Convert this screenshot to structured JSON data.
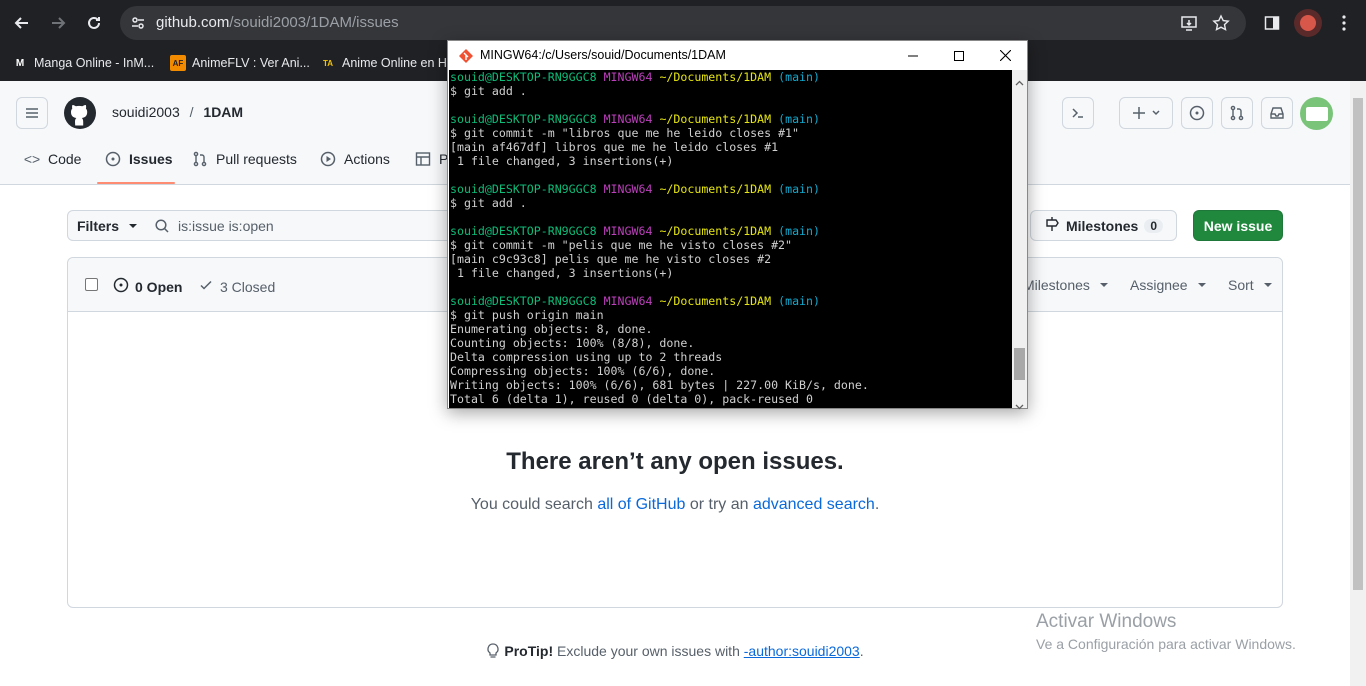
{
  "browser": {
    "url_host": "github.com",
    "url_path": "/souidi2003/1DAM/issues",
    "bookmarks": [
      {
        "label": "Manga Online - InM...",
        "icon": "M"
      },
      {
        "label": "AnimeFLV : Ver Ani...",
        "icon": "AF"
      },
      {
        "label": "Anime Online en H...",
        "icon": "TA"
      }
    ]
  },
  "github": {
    "owner": "souidi2003",
    "separator": "/",
    "repo": "1DAM",
    "tabs": {
      "code": "Code",
      "issues": "Issues",
      "pulls": "Pull requests",
      "actions": "Actions",
      "projects": "P"
    },
    "filters_label": "Filters",
    "search_value": "is:issue is:open",
    "milestones_label": "Milestones",
    "milestones_count": "0",
    "new_issue_label": "New issue",
    "open_label": "0 Open",
    "closed_label": "3 Closed",
    "milestones_filter": "Milestones",
    "assignee_filter": "Assignee",
    "sort_filter": "Sort",
    "blank_title": "There aren’t any open issues.",
    "blank_sub_prefix": "You could search ",
    "blank_sub_link1": "all of GitHub",
    "blank_sub_mid": " or try an ",
    "blank_sub_link2": "advanced search",
    "blank_sub_suffix": ".",
    "protip_bold": "ProTip!",
    "protip_text": " Exclude your own issues with ",
    "protip_code": "-author:souidi2003",
    "protip_end": "."
  },
  "windows_activation": {
    "title": "Activar Windows",
    "subtitle": "Ve a Configuración para activar Windows."
  },
  "terminal": {
    "title": "MINGW64:/c/Users/souid/Documents/1DAM",
    "prompt_user": "souid@DESKTOP-RN9GGC8",
    "prompt_env": "MINGW64",
    "prompt_path": "~/Documents/1DAM",
    "prompt_branch": "(main)",
    "lines": [
      {
        "type": "prompt"
      },
      {
        "type": "text",
        "text": "$ git add ."
      },
      {
        "type": "blank"
      },
      {
        "type": "prompt"
      },
      {
        "type": "text",
        "text": "$ git commit -m \"libros que me he leido closes #1\""
      },
      {
        "type": "text",
        "text": "[main af467df] libros que me he leido closes #1"
      },
      {
        "type": "text",
        "text": " 1 file changed, 3 insertions(+)"
      },
      {
        "type": "blank"
      },
      {
        "type": "prompt"
      },
      {
        "type": "text",
        "text": "$ git add ."
      },
      {
        "type": "blank"
      },
      {
        "type": "prompt"
      },
      {
        "type": "text",
        "text": "$ git commit -m \"pelis que me he visto closes #2\""
      },
      {
        "type": "text",
        "text": "[main c9c93c8] pelis que me he visto closes #2"
      },
      {
        "type": "text",
        "text": " 1 file changed, 3 insertions(+)"
      },
      {
        "type": "blank"
      },
      {
        "type": "prompt"
      },
      {
        "type": "text",
        "text": "$ git push origin main"
      },
      {
        "type": "text",
        "text": "Enumerating objects: 8, done."
      },
      {
        "type": "text",
        "text": "Counting objects: 100% (8/8), done."
      },
      {
        "type": "text",
        "text": "Delta compression using up to 2 threads"
      },
      {
        "type": "text",
        "text": "Compressing objects: 100% (6/6), done."
      },
      {
        "type": "text",
        "text": "Writing objects: 100% (6/6), 681 bytes | 227.00 KiB/s, done."
      },
      {
        "type": "text",
        "text": "Total 6 (delta 1), reused 0 (delta 0), pack-reused 0"
      }
    ]
  }
}
